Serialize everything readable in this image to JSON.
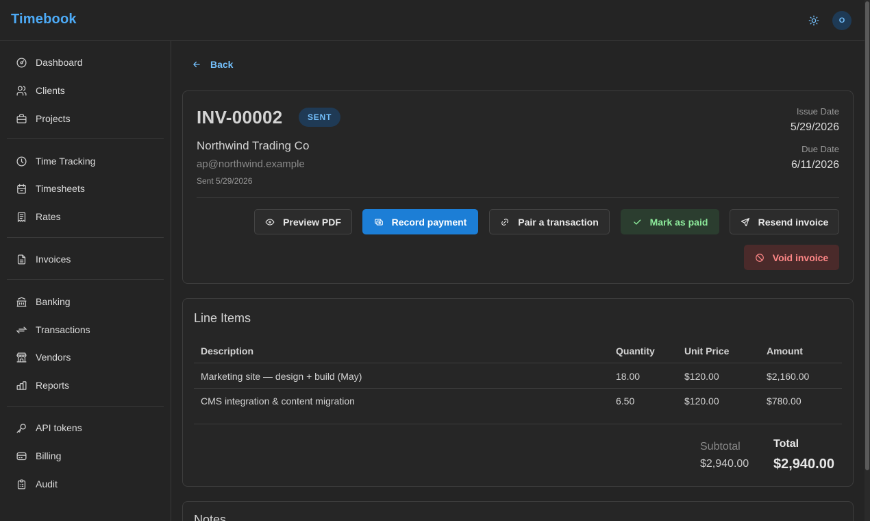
{
  "app": {
    "brand": "Timebook",
    "avatar_initial": "O"
  },
  "sidebar": {
    "items": [
      {
        "label": "Dashboard",
        "icon": "dashboard-gauge-icon"
      },
      {
        "label": "Clients",
        "icon": "users-icon"
      },
      {
        "label": "Projects",
        "icon": "briefcase-icon"
      },
      {
        "label": "Time Tracking",
        "icon": "clock-icon"
      },
      {
        "label": "Timesheets",
        "icon": "calendar-icon"
      },
      {
        "label": "Rates",
        "icon": "receipt-icon"
      },
      {
        "label": "Invoices",
        "icon": "file-invoice-icon"
      },
      {
        "label": "Banking",
        "icon": "bank-icon"
      },
      {
        "label": "Transactions",
        "icon": "arrows-exchange-icon"
      },
      {
        "label": "Vendors",
        "icon": "building-store-icon"
      },
      {
        "label": "Reports",
        "icon": "chart-bar-icon"
      },
      {
        "label": "API tokens",
        "icon": "key-icon"
      },
      {
        "label": "Billing",
        "icon": "credit-card-icon"
      },
      {
        "label": "Audit",
        "icon": "clipboard-check-icon"
      }
    ]
  },
  "page": {
    "back_label": "Back",
    "invoice_number": "INV-00002",
    "status": "SENT",
    "client_name": "Northwind Trading Co",
    "client_email": "ap@northwind.example",
    "sent_text": "Sent 5/29/2026",
    "issue_date_label": "Issue Date",
    "issue_date": "5/29/2026",
    "due_date_label": "Due Date",
    "due_date": "6/11/2026"
  },
  "actions": {
    "preview_pdf": "Preview PDF",
    "record_payment": "Record payment",
    "pair_transaction": "Pair a transaction",
    "mark_paid": "Mark as paid",
    "resend_invoice": "Resend invoice",
    "void_invoice": "Void invoice"
  },
  "line_items": {
    "title": "Line Items",
    "columns": [
      "Description",
      "Quantity",
      "Unit Price",
      "Amount"
    ],
    "rows": [
      {
        "description": "Marketing site — design + build (May)",
        "quantity": "18.00",
        "unit_price": "$120.00",
        "amount": "$2,160.00"
      },
      {
        "description": "CMS integration & content migration",
        "quantity": "6.50",
        "unit_price": "$120.00",
        "amount": "$780.00"
      }
    ],
    "subtotal_label": "Subtotal",
    "subtotal": "$2,940.00",
    "total_label": "Total",
    "total": "$2,940.00"
  },
  "notes": {
    "title": "Notes"
  },
  "colors": {
    "accent": "#4dabf7",
    "primary_button": "#1c7ed6",
    "success_text": "#8ce99a",
    "danger_text": "#ff8787",
    "background": "#242424"
  }
}
